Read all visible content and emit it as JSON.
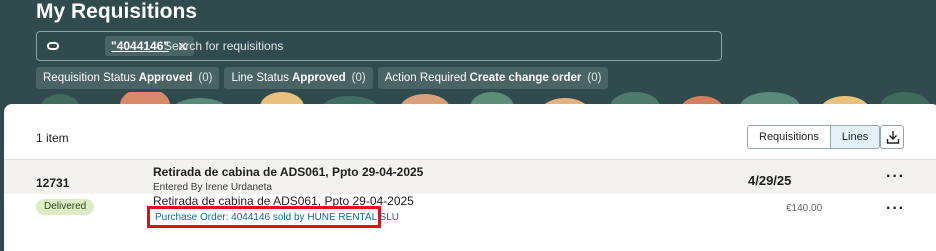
{
  "page": {
    "title": "My Requisitions"
  },
  "search": {
    "chip": "\"4044146\"",
    "placeholder": "Search for requisitions"
  },
  "filters": [
    {
      "label": "Requisition Status",
      "value": "Approved",
      "count": "(0)"
    },
    {
      "label": "Line Status",
      "value": "Approved",
      "count": "(0)"
    },
    {
      "label": "Action Required",
      "value": "Create change order",
      "count": "(0)"
    }
  ],
  "results": {
    "count": "1 item",
    "view_toggle": {
      "requisitions": "Requisitions",
      "lines": "Lines",
      "selected": "Lines"
    }
  },
  "requisition": {
    "number": "12731",
    "title": "Retirada de cabina de ADS061, Ppto 29-04-2025",
    "entered_by": "Entered By Irene Urdaneta",
    "date": "4/29/25",
    "line": {
      "status": "Delivered",
      "description": "Retirada de cabina de ADS061, Ppto 29-04-2025",
      "purchase_order": "Purchase Order: 4044146 sold by HUNE RENTAL SLU",
      "amount": "€140.00"
    }
  },
  "colors": {
    "header_bg": "#2f4b4d",
    "chip_bg": "#4a6466",
    "badge_bg": "#dcecc4",
    "link": "#0e6a9b",
    "highlight_box": "#e0101b"
  },
  "icons": [
    "search-toggle-icon",
    "close-icon",
    "download-icon",
    "more-icon"
  ]
}
